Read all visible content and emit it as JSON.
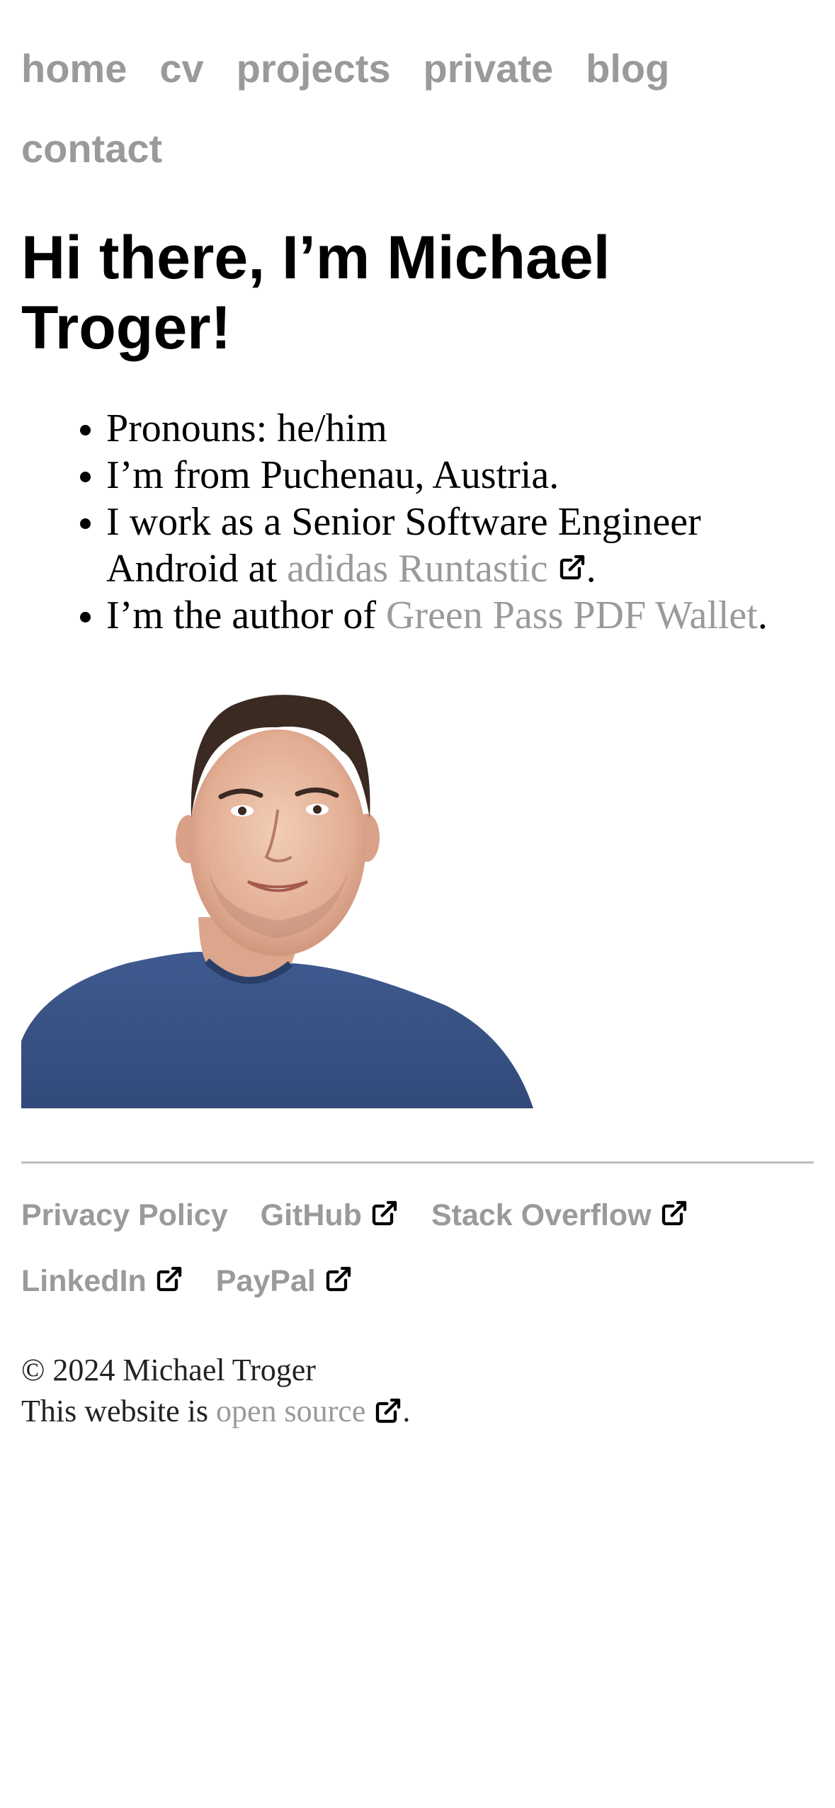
{
  "nav": {
    "items": [
      {
        "label": "home"
      },
      {
        "label": "cv"
      },
      {
        "label": "projects"
      },
      {
        "label": "private"
      },
      {
        "label": "blog"
      },
      {
        "label": "contact"
      }
    ]
  },
  "hero": {
    "title": "Hi there, I’m Michael Troger!"
  },
  "facts": {
    "pronouns": "Pronouns: he/him",
    "origin": "I’m from Puchenau, Austria.",
    "work_prefix": "I work as a Senior Software Engineer Android at ",
    "work_link": "adidas Runtastic",
    "work_suffix": ".",
    "author_prefix": "I’m the author of ",
    "author_link": "Green Pass PDF Wallet",
    "author_suffix": "."
  },
  "footer": {
    "links": [
      {
        "label": "Privacy Policy"
      },
      {
        "label": "GitHub"
      },
      {
        "label": "Stack Overflow"
      },
      {
        "label": "LinkedIn"
      },
      {
        "label": "PayPal"
      }
    ],
    "copyright": "© 2024 Michael Troger",
    "source_prefix": "This website is ",
    "source_link": "open source",
    "source_suffix": "."
  },
  "icons": {
    "external": "external-link-icon"
  },
  "colors": {
    "link": "#9a9a9a",
    "text": "#000000",
    "divider": "#bdbdbd",
    "shirt": "#3b5487"
  }
}
